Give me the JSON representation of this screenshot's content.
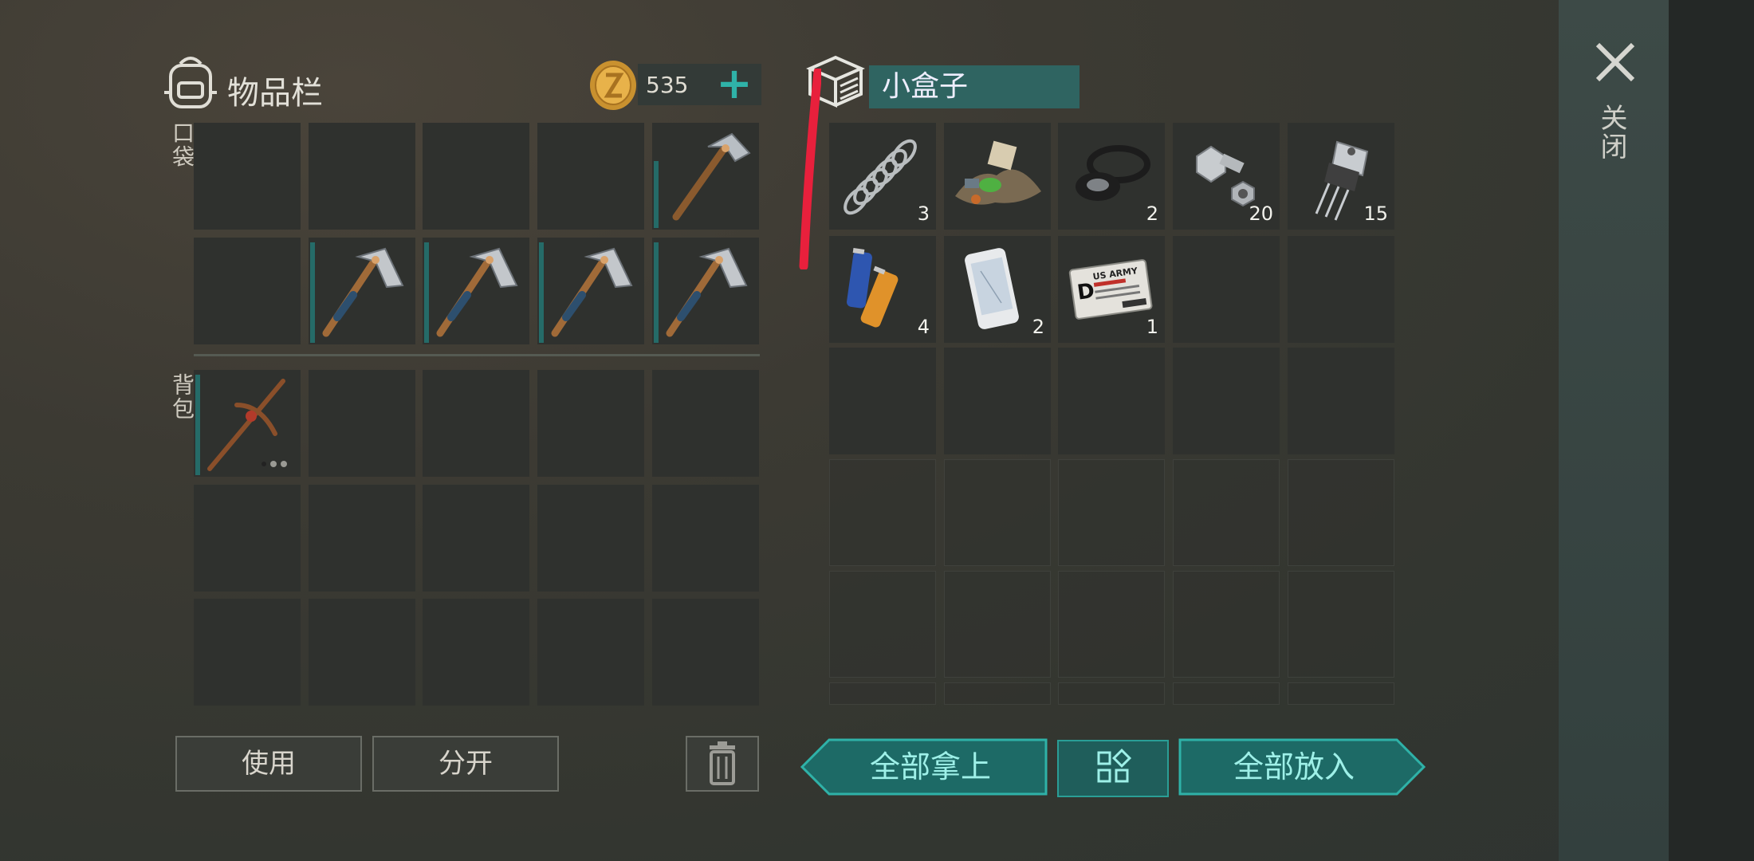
{
  "inventory": {
    "title": "物品栏",
    "coins": "535",
    "pocket_label": "口袋",
    "backpack_label": "背包",
    "pocket_slots": [
      {
        "item": "",
        "count": ""
      },
      {
        "item": "",
        "count": ""
      },
      {
        "item": "",
        "count": ""
      },
      {
        "item": "",
        "count": ""
      },
      {
        "item": "hatchet",
        "count": ""
      },
      {
        "item": "",
        "count": ""
      },
      {
        "item": "hatchet",
        "count": ""
      },
      {
        "item": "hatchet",
        "count": ""
      },
      {
        "item": "hatchet",
        "count": ""
      },
      {
        "item": "hatchet",
        "count": ""
      }
    ],
    "backpack_slots": [
      {
        "item": "pickaxe",
        "count": ""
      }
    ]
  },
  "container": {
    "name": "小盒子",
    "items": [
      {
        "item": "spring",
        "count": "3"
      },
      {
        "item": "scrap-pile",
        "count": ""
      },
      {
        "item": "rubber-seals",
        "count": "2"
      },
      {
        "item": "bolt-and-nut",
        "count": "20"
      },
      {
        "item": "transistor",
        "count": "15"
      },
      {
        "item": "batteries",
        "count": "4"
      },
      {
        "item": "smartphone",
        "count": "2"
      },
      {
        "item": "army-id-card",
        "count": "1"
      }
    ],
    "id_card_text": "US ARMY"
  },
  "buttons": {
    "use": "使用",
    "split": "分开",
    "take_all": "全部拿上",
    "put_all": "全部放入",
    "close": "关闭"
  },
  "colors": {
    "accent": "#2fb2a8",
    "durability": "#256b68",
    "slot_bg": "#2f312e",
    "annotation_red": "#e8203c"
  }
}
